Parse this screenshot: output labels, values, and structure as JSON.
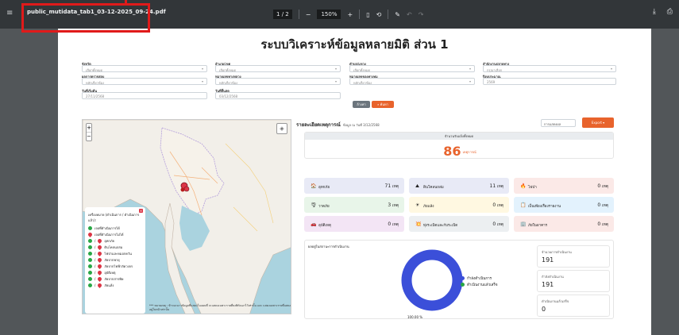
{
  "toolbar": {
    "filename": "public_mutidata_tab1_03-12-2025_09-24.pdf",
    "page_current": "1",
    "page_sep": "/",
    "page_total": "2",
    "zoom": "150%",
    "zoom_out": "−",
    "zoom_in": "+"
  },
  "doc": {
    "title": "ระบบวิเคราะห์ข้อมูลหลายมิติ ส่วน 1",
    "filters": {
      "province_label": "จังหวัด",
      "province_value": "เลือกทั้งหมด",
      "district_label": "อำเภอ/เขต",
      "district_value": "เลือกทั้งหมด",
      "subdistrict_label": "ตำบล/แขวง",
      "subdistrict_value": "เลือกทั้งหมด",
      "agency_label": "สำนักงานปลายทาง",
      "agency_value": "กรุณาเลือก",
      "type_label": "ผลการตรวจสอบ",
      "type_value": "หลักเกี่ยวข้อง",
      "category_label": "หมายเลขทางหลวง",
      "category_value": "หลักเกี่ยวข้อง",
      "subcategory_label": "หมายเลขของทางทุม",
      "subcategory_value": "หลักเกี่ยวข้อง",
      "year_label": "ปีงบประมาณ",
      "year_value": "2569",
      "start_label": "วันที่เริ่มต้น",
      "start_value": "27/11/2568",
      "end_label": "วันที่สิ้นสุด",
      "end_value": "03/12/2568",
      "clear_btn": "ล้างค่า",
      "search_btn": "ค้นหา"
    },
    "map": {
      "zoom_in": "+",
      "zoom_out": "−",
      "legend_title": "เครื่องหมาย (ดำเนินการ / ดำเนินการแล้ว):",
      "legend_items": [
        {
          "label": "เจอที่ดำเนินการได้",
          "kind": "green"
        },
        {
          "label": "เจอที่ดำเนินการไม่ได้",
          "kind": "red"
        },
        {
          "label": "อุทกภัย",
          "kind": "both"
        },
        {
          "label": "ดินโคลนถล่ม",
          "kind": "both"
        },
        {
          "label": "ไฟป่าและหมอกควัน",
          "kind": "both"
        },
        {
          "label": "ภัยจากพายุ",
          "kind": "both"
        },
        {
          "label": "ภัยจากไฟฟ้าลัดวงจร",
          "kind": "both"
        },
        {
          "label": "อุบัติเหตุ",
          "kind": "both"
        },
        {
          "label": "ภัยจากสารพิษ",
          "kind": "both"
        },
        {
          "label": "ภัยแล้ง",
          "kind": "both"
        }
      ],
      "attribution": "*** หมายเหตุ : ข้าวมะนาวข้อมูลที่แสดงในแผนที่ จะแสดงเฉพาะรายที่ลงพิกัดเอาไว้เท่านั้น และ แสดงเฉพาะรายที่แสดงอยู่ในหน้าเท่านั้น"
    },
    "report": {
      "title": "รายละเอียดเหตุการณ์",
      "subtitle": "ข้อมูล ณ วันที่ 3/12/2568",
      "select_value": "การแสดงผล",
      "export_label": "Export ▾",
      "summary_header": "จำนวนรับแจ้งทั้งหมด",
      "total": "86",
      "total_unit": "เหตุการณ์",
      "cards": [
        {
          "label": "อุทกภัย",
          "value": "71",
          "unit": "เหตุ",
          "icon": "🏠",
          "bg": "#e8eaf6"
        },
        {
          "label": "ดินโคลนถล่ม",
          "value": "11",
          "unit": "เหตุ",
          "icon": "⛰",
          "bg": "#e8eaf6"
        },
        {
          "label": "ไฟป่า",
          "value": "0",
          "unit": "เหตุ",
          "icon": "🔥",
          "bg": "#fbe9e7"
        },
        {
          "label": "วาตภัย",
          "value": "3",
          "unit": "เหตุ",
          "icon": "🌪",
          "bg": "#e8f5e9"
        },
        {
          "label": "ภัยแล้ง",
          "value": "0",
          "unit": "เหตุ",
          "icon": "☀",
          "bg": "#fff8e1"
        },
        {
          "label": "เป็นเพียงเรื่องรายงาน",
          "value": "0",
          "unit": "เหตุ",
          "icon": "📋",
          "bg": "#e3f2fd"
        },
        {
          "label": "อุบัติเหตุ",
          "value": "0",
          "unit": "เหตุ",
          "icon": "🚗",
          "bg": "#f3e5f5"
        },
        {
          "label": "ทุ่งระเบิดและกับระเบิด",
          "value": "0",
          "unit": "เหตุ",
          "icon": "💥",
          "bg": "#eceff1"
        },
        {
          "label": "ภัยในอาคาร",
          "value": "0",
          "unit": "เหตุ",
          "icon": "🏢",
          "bg": "#fbe9e7"
        }
      ]
    },
    "progress": {
      "title": "ผลอยู่ในสถานะการดำเนินงาน",
      "legend_in_progress": "กำลังดำเนินการ",
      "legend_done": "ดำเนินงานแล้วเสร็จ",
      "pct_label": "100.00 %",
      "stats": [
        {
          "label": "จำนวนการดำเนินงาน",
          "value": "191"
        },
        {
          "label": "กำลังดำเนินงาน",
          "value": "191"
        },
        {
          "label": "ดำเนินงานแล้วเสร็จ",
          "value": "0"
        }
      ]
    }
  },
  "chart_data": {
    "type": "pie",
    "categories": [
      "กำลังดำเนินการ",
      "ดำเนินงานแล้วเสร็จ"
    ],
    "values": [
      191,
      0
    ],
    "colors": [
      "#3b4fd9",
      "#28a745"
    ],
    "donut": true
  }
}
